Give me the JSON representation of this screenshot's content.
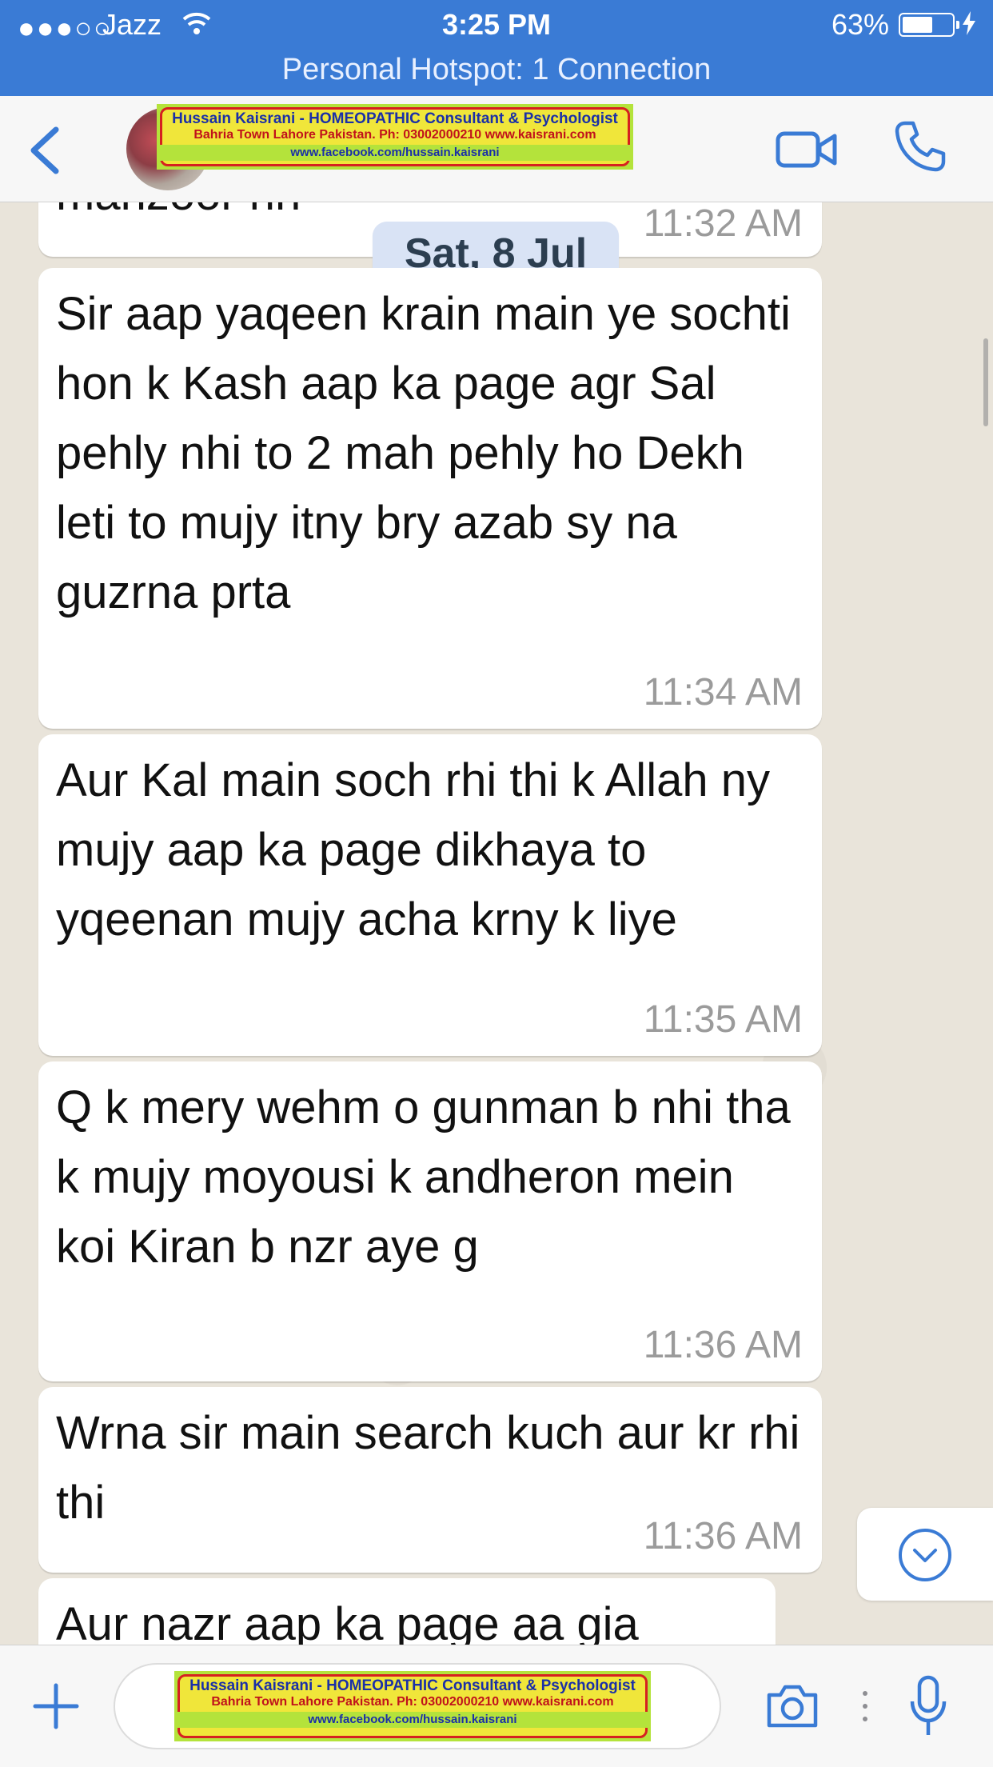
{
  "status_bar": {
    "signal": "●●●○○",
    "carrier": "Jazz",
    "time": "3:25 PM",
    "battery_percent": "63%",
    "battery_level": 0.63,
    "hotspot": "Personal Hotspot: 1 Connection"
  },
  "header": {
    "banner_line1": "Hussain Kaisrani - HOMEOPATHIC Consultant & Psychologist",
    "banner_line2": "Bahria Town Lahore Pakistan. Ph: 03002000210    www.kaisrani.com",
    "banner_line3": "www.facebook.com/hussain.kaisrani"
  },
  "chat": {
    "date_chip": "Sat, 8 Jul",
    "partial_top": {
      "text": "manzoor hn",
      "time": "11:32 AM"
    },
    "messages": [
      {
        "text": "Sir aap yaqeen krain main ye sochti hon k Kash aap ka page agr Sal pehly nhi to 2 mah pehly ho Dekh leti to mujy itny bry azab sy na guzrna prta",
        "time": "11:34 AM"
      },
      {
        "text": "Aur Kal main soch rhi thi k Allah ny mujy aap ka page dikhaya to yqeenan mujy acha krny k liye",
        "time": "11:35 AM"
      },
      {
        "text": "Q k mery wehm o gunman b nhi tha k mujy moyousi k andheron mein koi Kiran b nzr aye g",
        "time": "11:36 AM"
      },
      {
        "text": "Wrna sir main search kuch aur kr rhi thi",
        "time": "11:36 AM"
      },
      {
        "text": "Aur nazr aap ka page aa gia",
        "time": ""
      }
    ]
  },
  "input_bar": {
    "banner_line1": "Hussain Kaisrani - HOMEOPATHIC Consultant & Psychologist",
    "banner_line2": "Bahria Town Lahore Pakistan. Ph: 03002000210    www.kaisrani.com",
    "banner_line3": "www.facebook.com/hussain.kaisrani"
  },
  "colors": {
    "accent": "#3a7bd5",
    "bubble": "#ffffff",
    "timestamp": "#9b9b9b",
    "date_chip": "#d9e3f5"
  }
}
